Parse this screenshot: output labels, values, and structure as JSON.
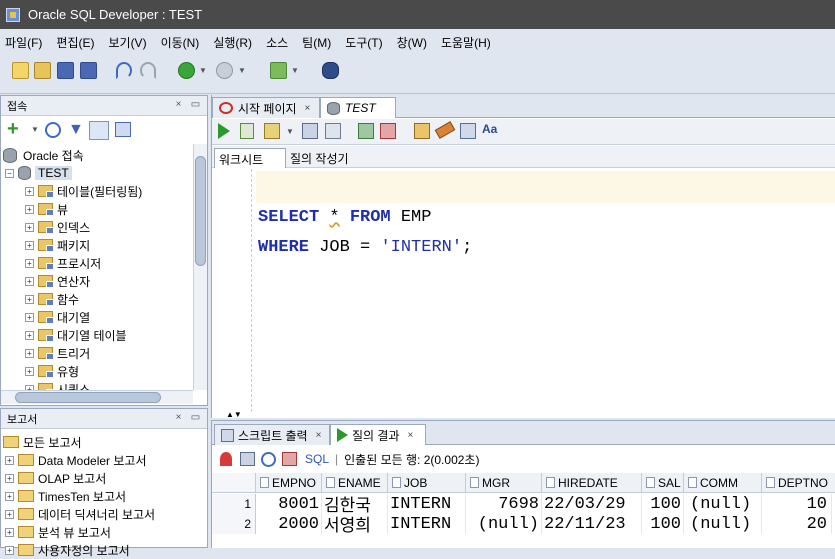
{
  "window": {
    "title": "Oracle SQL Developer : TEST"
  },
  "menu": [
    "파일(F)",
    "편집(E)",
    "보기(V)",
    "이동(N)",
    "실행(R)",
    "소스",
    "팀(M)",
    "도구(T)",
    "창(W)",
    "도움말(H)"
  ],
  "connections_panel": {
    "title": "접속",
    "root": "Oracle 접속",
    "connection": "TEST",
    "items": [
      "테이블(필터링됨)",
      "뷰",
      "인덱스",
      "패키지",
      "프로시저",
      "연산자",
      "함수",
      "대기열",
      "대기열 테이블",
      "트리거",
      "유형",
      "시퀀스"
    ]
  },
  "reports_panel": {
    "title": "보고서",
    "items": [
      "모든 보고서",
      "Data Modeler 보고서",
      "OLAP 보고서",
      "TimesTen 보고서",
      "데이터 딕셔너리 보고서",
      "분석 뷰 보고서",
      "사용자정의 보고서"
    ]
  },
  "editor": {
    "tabs": [
      "시작 페이지",
      "TEST"
    ],
    "subtabs": [
      "워크시트",
      "질의 작성기"
    ],
    "code_line1": {
      "kw1": "SELECT",
      "star": "*",
      "kw2": "FROM",
      "table": "EMP"
    },
    "code_line2": {
      "kw1": "WHERE",
      "col": "JOB",
      "op": "=",
      "value": "'INTERN'",
      "semi": ";"
    }
  },
  "results": {
    "tabs": [
      "스크립트 출력",
      "질의 결과"
    ],
    "sql_label": "SQL",
    "status": "인출된 모든 행: 2(0.002초)",
    "columns": [
      "EMPNO",
      "ENAME",
      "JOB",
      "MGR",
      "HIREDATE",
      "SAL",
      "COMM",
      "DEPTNO"
    ],
    "rows": [
      {
        "n": "1",
        "EMPNO": "8001",
        "ENAME": "김한국",
        "JOB": "INTERN",
        "MGR": "7698",
        "HIREDATE": "22/03/29",
        "SAL": "100",
        "COMM": "(null)",
        "DEPTNO": "10"
      },
      {
        "n": "2",
        "EMPNO": "2000",
        "ENAME": "서영희",
        "JOB": "INTERN",
        "MGR": "(null)",
        "HIREDATE": "22/11/23",
        "SAL": "100",
        "COMM": "(null)",
        "DEPTNO": "20"
      }
    ]
  }
}
